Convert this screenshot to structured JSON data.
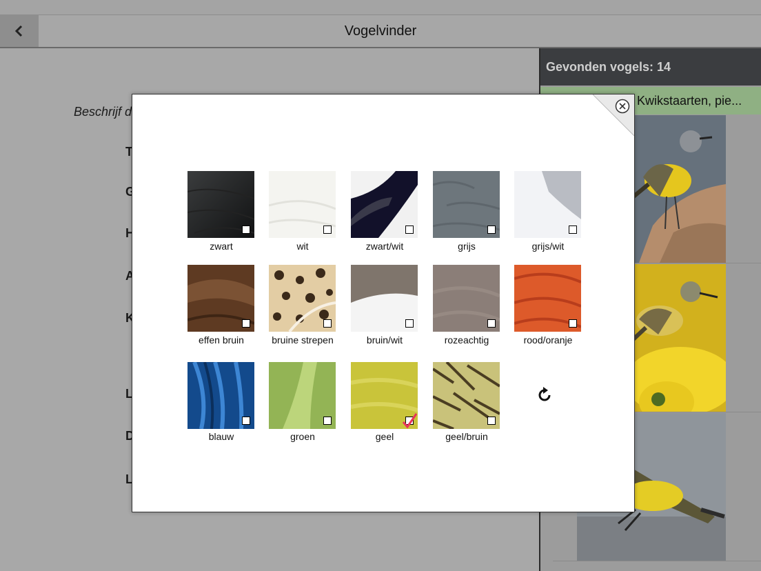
{
  "app": {
    "title": "Vogelvinder"
  },
  "main": {
    "prompt": "Beschrijf d",
    "criteria": [
      "T",
      "G",
      "H",
      "A",
      "K",
      "L",
      "D",
      "L"
    ]
  },
  "sidebar": {
    "found_label": "Gevonden vogels: 14",
    "group_label": "Kwikstaarten, pie..."
  },
  "colors": {
    "accent_check": "#e8345a",
    "sidebar_header": "#3b3d40",
    "group_row": "#8fb083"
  },
  "modal": {
    "swatches": [
      {
        "label": "zwart",
        "checked": false
      },
      {
        "label": "wit",
        "checked": false
      },
      {
        "label": "zwart/wit",
        "checked": false
      },
      {
        "label": "grijs",
        "checked": false
      },
      {
        "label": "grijs/wit",
        "checked": false
      },
      {
        "label": "effen bruin",
        "checked": false
      },
      {
        "label": "bruine strepen",
        "checked": false
      },
      {
        "label": "bruin/wit",
        "checked": false
      },
      {
        "label": "rozeachtig",
        "checked": false
      },
      {
        "label": "rood/oranje",
        "checked": false
      },
      {
        "label": "blauw",
        "checked": false
      },
      {
        "label": "groen",
        "checked": false
      },
      {
        "label": "geel",
        "checked": true
      },
      {
        "label": "geel/bruin",
        "checked": false
      }
    ],
    "icons": {
      "close": "close-circle-icon",
      "reset": "refresh-icon",
      "back": "chevron-left-icon"
    }
  }
}
